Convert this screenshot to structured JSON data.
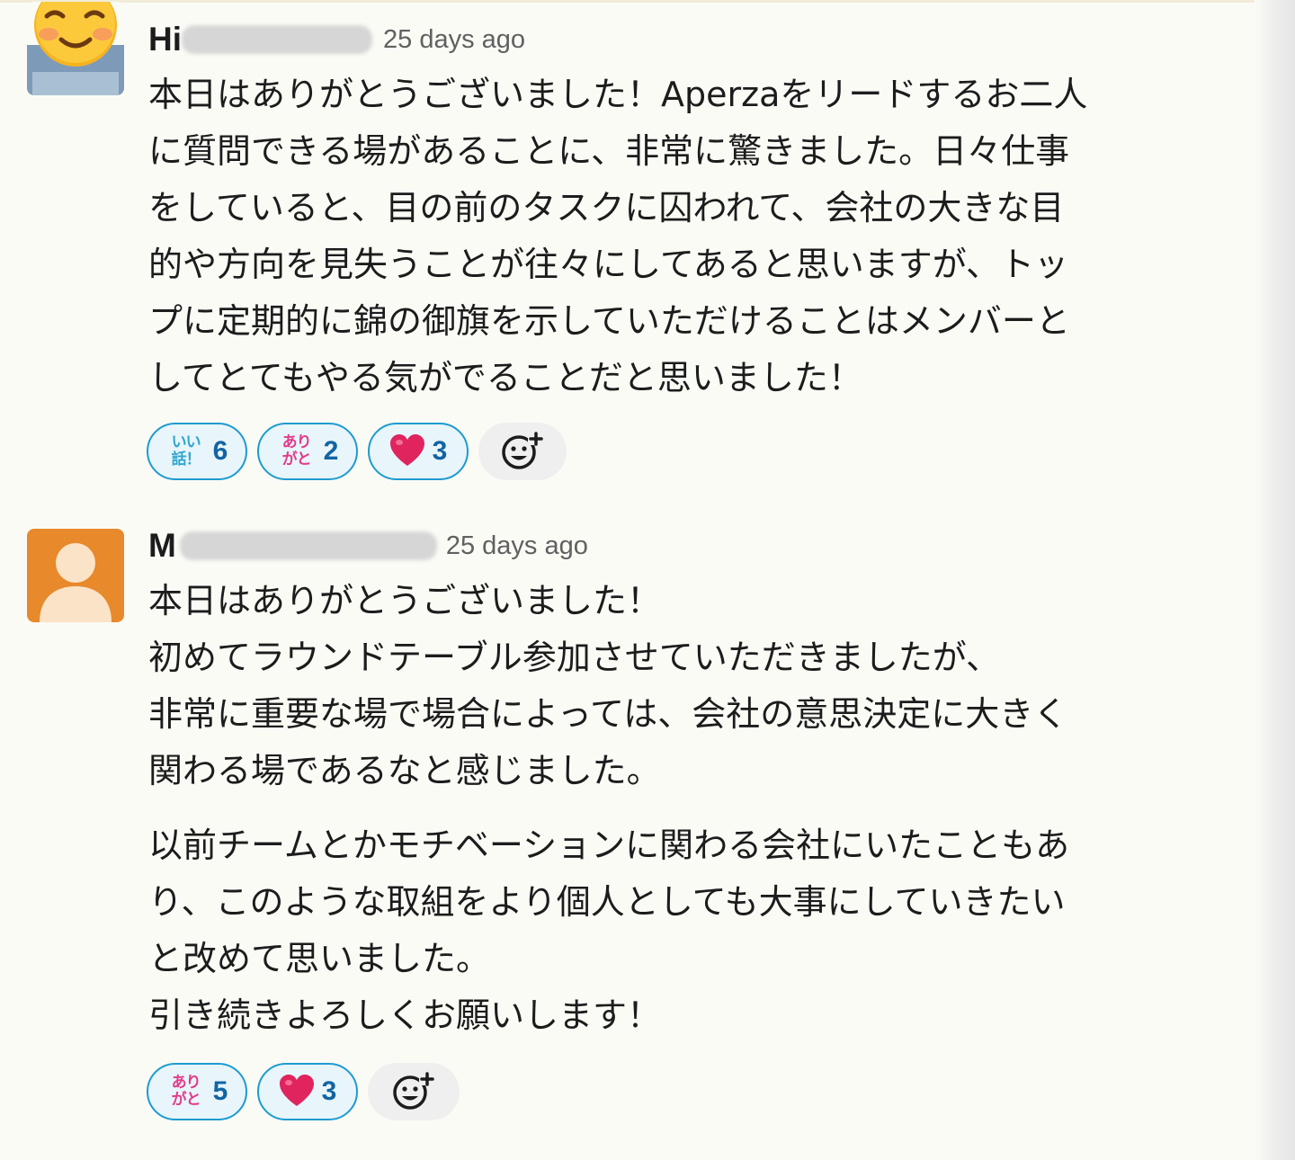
{
  "messages": [
    {
      "author": "Hi",
      "timestamp": "25 days ago",
      "lines": [
        "本日はありがとうございました！Aperzaをリードするお二人",
        "に質問できる場があることに、非常に驚きました。日々仕事",
        "をしていると、目の前のタスクに囚われて、会社の大きな目",
        "的や方向を見失うことが往々にしてあると思いますが、トッ",
        "プに定期的に錦の御旗を示していただけることはメンバーと",
        "してとてもやる気がでることだと思いました！"
      ],
      "reactions": [
        {
          "emoji_icon": "iihanashi-emoji",
          "emoji_text": "いい話！",
          "count": "6"
        },
        {
          "emoji_icon": "arigato-emoji",
          "emoji_text": "ありがと",
          "count": "2"
        },
        {
          "emoji_icon": "heart-icon",
          "count": "3"
        }
      ]
    },
    {
      "author": "M",
      "timestamp": "25 days ago",
      "paragraph1": [
        "本日はありがとうございました！",
        "初めてラウンドテーブル参加させていただきましたが、",
        "非常に重要な場で場合によっては、会社の意思決定に大きく",
        "関わる場であるなと感じました。"
      ],
      "paragraph2": [
        "以前チームとかモチベーションに関わる会社にいたこともあ",
        "り、このような取組をより個人としても大事にしていきたい",
        "と改めて思いました。",
        "引き続きよろしくお願いします！"
      ],
      "reactions": [
        {
          "emoji_icon": "arigato-emoji",
          "emoji_text": "ありがと",
          "count": "5"
        },
        {
          "emoji_icon": "heart-icon",
          "count": "3"
        }
      ]
    }
  ],
  "colors": {
    "reaction_border": "#1d9bd1",
    "reaction_bg": "#e8f5fa",
    "reaction_count": "#1264a3",
    "default_avatar_bg": "#e8892b",
    "heart": "#e0245e"
  }
}
